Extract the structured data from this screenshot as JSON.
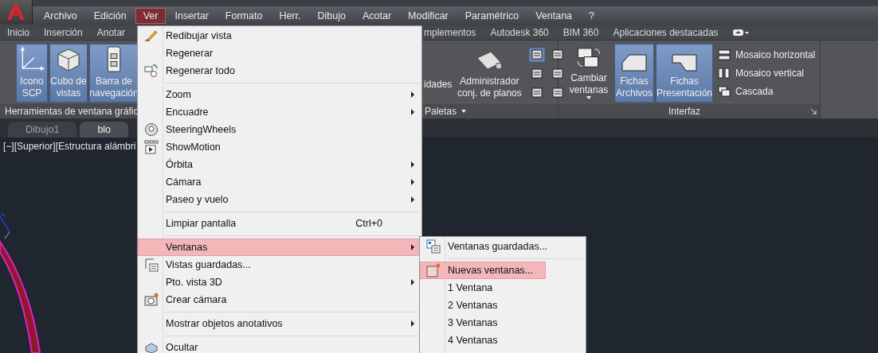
{
  "menubar": {
    "items": [
      {
        "label": "Archivo",
        "selected": false
      },
      {
        "label": "Edición",
        "selected": false
      },
      {
        "label": "Ver",
        "selected": true
      },
      {
        "label": "Insertar",
        "selected": false
      },
      {
        "label": "Formato",
        "selected": false
      },
      {
        "label": "Herr.",
        "selected": false
      },
      {
        "label": "Dibujo",
        "selected": false
      },
      {
        "label": "Acotar",
        "selected": false
      },
      {
        "label": "Modificar",
        "selected": false
      },
      {
        "label": "Paramétrico",
        "selected": false
      },
      {
        "label": "Ventana",
        "selected": false
      },
      {
        "label": "?",
        "selected": false
      }
    ]
  },
  "ribbon_tabs": {
    "left": [
      "Inicio",
      "Inserción",
      "Anotar"
    ],
    "right": [
      "mplementos",
      "Autodesk 360",
      "BIM 360",
      "Aplicaciones destacadas"
    ]
  },
  "ribbon": {
    "left_panel": {
      "title": "Herramientas de ventana gráfic",
      "buttons": [
        {
          "lines": [
            "Icono",
            "SCP"
          ],
          "selected": true
        },
        {
          "lines": [
            "Cubo de",
            "vistas"
          ],
          "selected": true
        },
        {
          "lines": [
            "Barra de",
            "navegación"
          ],
          "selected": true
        }
      ]
    },
    "paletas_panel": {
      "title": "Paletas",
      "cut_label": "idades",
      "buttons": [
        {
          "lines": [
            "Administrador",
            "conj. de planos"
          ],
          "selected": false
        }
      ]
    },
    "interfaz_panel": {
      "title": "Interfaz",
      "buttons": [
        {
          "lines": [
            "Cambiar",
            "ventanas"
          ],
          "selected": false,
          "dropdown": true
        },
        {
          "lines": [
            "Fichas",
            "Archivos"
          ],
          "selected": true,
          "dropdown": false
        },
        {
          "lines": [
            "Fichas",
            "Presentación"
          ],
          "selected": true,
          "dropdown": false
        }
      ],
      "list": [
        "Mosaico horizontal",
        "Mosaico vertical",
        "Cascada"
      ]
    }
  },
  "file_tabs": [
    {
      "label": "Dibujo1",
      "selected": false
    },
    {
      "label": "blo",
      "selected": true
    }
  ],
  "viewport": {
    "label": "[−][Superior][Estructura alámbri"
  },
  "menu": {
    "items": [
      {
        "kind": "item",
        "label": "Redibujar vista",
        "submenu": false,
        "selected": false
      },
      {
        "kind": "item",
        "label": "Regenerar",
        "submenu": false,
        "selected": false
      },
      {
        "kind": "item",
        "label": "Regenerar todo",
        "submenu": false,
        "selected": false
      },
      {
        "kind": "separator"
      },
      {
        "kind": "item",
        "label": "Zoom",
        "submenu": true,
        "selected": false
      },
      {
        "kind": "item",
        "label": "Encuadre",
        "submenu": true,
        "selected": false
      },
      {
        "kind": "item",
        "label": "SteeringWheels",
        "submenu": false,
        "selected": false
      },
      {
        "kind": "item",
        "label": "ShowMotion",
        "submenu": false,
        "selected": false
      },
      {
        "kind": "item",
        "label": "Órbita",
        "submenu": true,
        "selected": false
      },
      {
        "kind": "item",
        "label": "Cámara",
        "submenu": true,
        "selected": false
      },
      {
        "kind": "item",
        "label": "Paseo y vuelo",
        "submenu": true,
        "selected": false
      },
      {
        "kind": "separator"
      },
      {
        "kind": "item",
        "label": "Limpiar pantalla",
        "shortcut": "Ctrl+0",
        "submenu": false,
        "selected": false
      },
      {
        "kind": "separator"
      },
      {
        "kind": "item",
        "label": "Ventanas",
        "submenu": true,
        "selected": true
      },
      {
        "kind": "item",
        "label": "Vistas guardadas...",
        "submenu": false,
        "selected": false
      },
      {
        "kind": "item",
        "label": "Pto. vista 3D",
        "submenu": true,
        "selected": false
      },
      {
        "kind": "item",
        "label": "Crear cámara",
        "submenu": false,
        "selected": false
      },
      {
        "kind": "separator"
      },
      {
        "kind": "item",
        "label": "Mostrar objetos anotativos",
        "submenu": true,
        "selected": false
      },
      {
        "kind": "separator"
      },
      {
        "kind": "item",
        "label": "Ocultar",
        "submenu": false,
        "selected": false
      }
    ]
  },
  "submenu": {
    "items": [
      {
        "kind": "item",
        "label": "Ventanas guardadas...",
        "selected": false
      },
      {
        "kind": "separator"
      },
      {
        "kind": "item",
        "label": "Nuevas ventanas...",
        "selected": true
      },
      {
        "kind": "item",
        "label": "1 Ventana",
        "selected": false
      },
      {
        "kind": "item",
        "label": "2 Ventanas",
        "selected": false
      },
      {
        "kind": "item",
        "label": "3 Ventanas",
        "selected": false
      },
      {
        "kind": "item",
        "label": "4 Ventanas",
        "selected": false
      }
    ]
  }
}
